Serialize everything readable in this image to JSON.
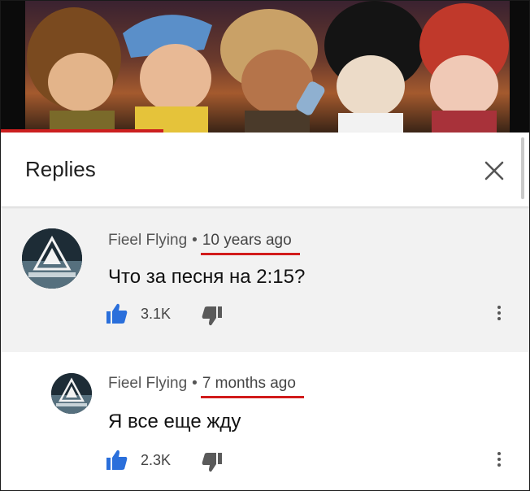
{
  "header": {
    "title": "Replies",
    "close_icon": "close-icon"
  },
  "comments": [
    {
      "author": "Fieel Flying",
      "separator": "•",
      "time": "10 years ago",
      "text": "Что за песня на 2:15?",
      "likes": "3.1K",
      "like_icon": "thumb-up-icon",
      "dislike_icon": "thumb-down-icon",
      "more_icon": "more-vert-icon"
    },
    {
      "author": "Fieel Flying",
      "separator": "•",
      "time": "7 months ago",
      "text": "Я все еще жду",
      "likes": "2.3K",
      "like_icon": "thumb-up-icon",
      "dislike_icon": "thumb-down-icon",
      "more_icon": "more-vert-icon"
    }
  ],
  "colors": {
    "like_blue": "#2a6fdb",
    "icon_gray": "#5a5a5a",
    "underline_red": "#d11b1b",
    "progress_red": "#cc1f1f"
  }
}
